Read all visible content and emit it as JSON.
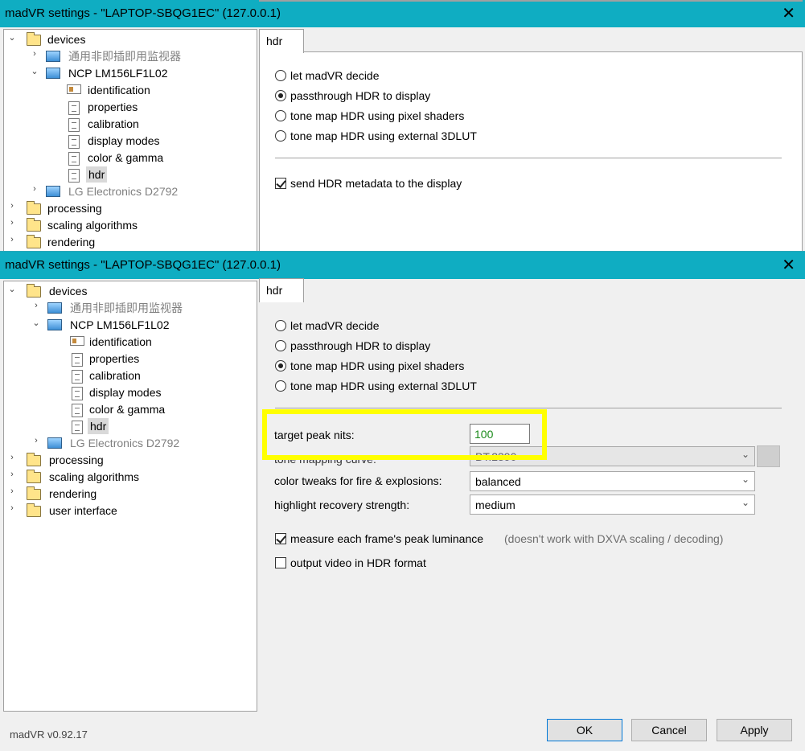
{
  "window1": {
    "title": "madVR settings - \"LAPTOP-SBQG1EC\" (127.0.0.1)",
    "tab": "hdr",
    "tree": [
      "devices",
      "通用非即插即用监视器",
      "NCP LM156LF1L02",
      "identification",
      "properties",
      "calibration",
      "display modes",
      "color & gamma",
      "hdr",
      "LG Electronics D2792",
      "processing",
      "scaling algorithms",
      "rendering"
    ],
    "radios": [
      "let madVR decide",
      "passthrough HDR to display",
      "tone map HDR using pixel shaders",
      "tone map HDR using external 3DLUT"
    ],
    "selected_radio": "passthrough HDR to display",
    "checkbox": "send HDR metadata to the display"
  },
  "window2": {
    "title": "madVR settings - \"LAPTOP-SBQG1EC\" (127.0.0.1)",
    "tab": "hdr",
    "tree": [
      "devices",
      "通用非即插即用监视器",
      "NCP LM156LF1L02",
      "identification",
      "properties",
      "calibration",
      "display modes",
      "color & gamma",
      "hdr",
      "LG Electronics D2792",
      "processing",
      "scaling algorithms",
      "rendering",
      "user interface"
    ],
    "radios": [
      "let madVR decide",
      "passthrough HDR to display",
      "tone map HDR using pixel shaders",
      "tone map HDR using external 3DLUT"
    ],
    "selected_radio": "tone map HDR using pixel shaders",
    "target_peak_label": "target peak nits:",
    "target_peak_value": "100",
    "tone_curve_label": "tone mapping curve:",
    "tone_curve_value": "BT.2390",
    "color_tweaks_label": "color tweaks for fire & explosions:",
    "color_tweaks_value": "balanced",
    "highlight_label": "highlight recovery strength:",
    "highlight_value": "medium",
    "measure_label": "measure each frame's peak luminance",
    "measure_note": "(doesn't work with DXVA scaling / decoding)",
    "output_hdr_label": "output video in HDR format",
    "version": "madVR v0.92.17",
    "buttons": {
      "ok": "OK",
      "cancel": "Cancel",
      "apply": "Apply"
    }
  }
}
